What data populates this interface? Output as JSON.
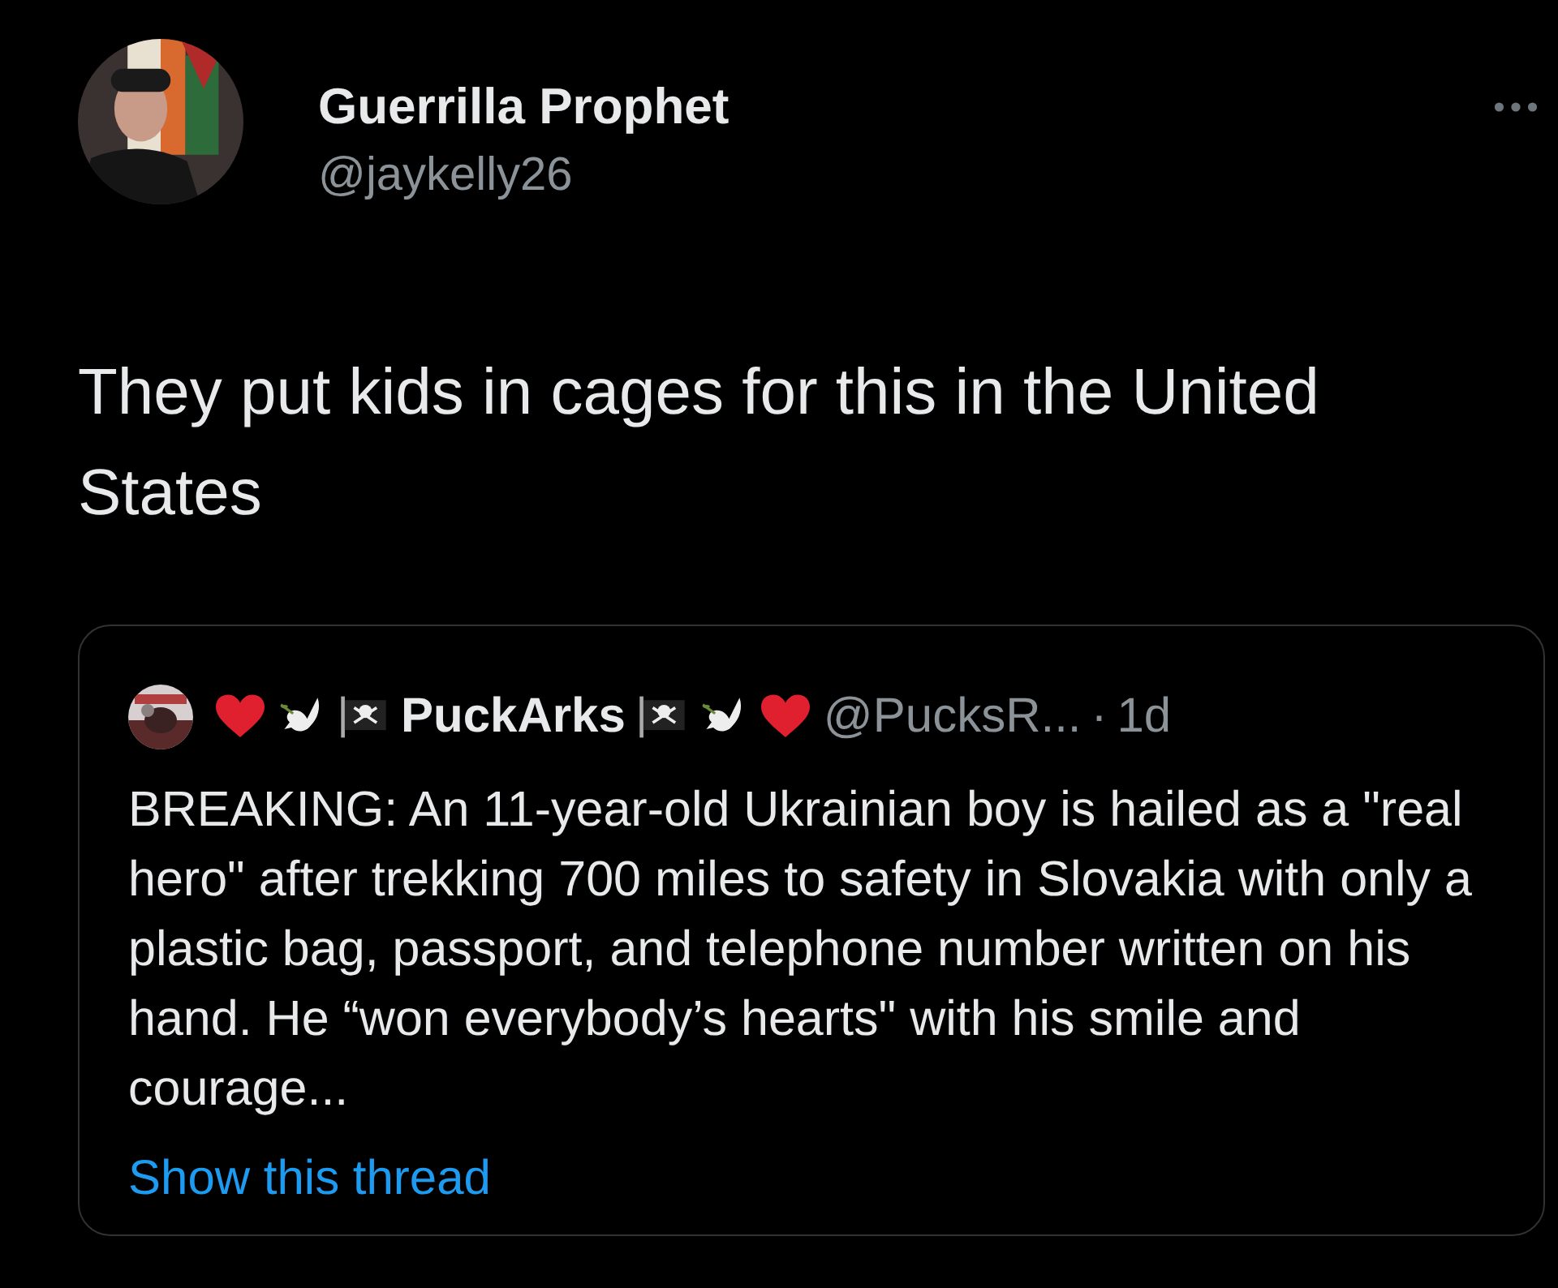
{
  "author": {
    "name": "Guerrilla Prophet",
    "handle": "@jaykelly26"
  },
  "text": "They put kids in cages for this in the United States",
  "quote": {
    "name": "PuckArks",
    "handle": "@PucksR...",
    "separator": "·",
    "time": "1d",
    "name_icons_before": [
      {
        "kind": "heart"
      },
      {
        "kind": "dove"
      },
      {
        "kind": "pirate-flag"
      }
    ],
    "name_icons_after": [
      {
        "kind": "pirate-flag"
      },
      {
        "kind": "dove"
      },
      {
        "kind": "heart"
      }
    ],
    "text": "BREAKING: An 11-year-old Ukrainian boy is hailed as a \"real hero\" after trekking 700 miles to safety in Slovakia with only a plastic bag, passport, and telephone number written on his hand. He “won everybody’s hearts\" with his smile and courage...",
    "link": "Show this thread"
  }
}
